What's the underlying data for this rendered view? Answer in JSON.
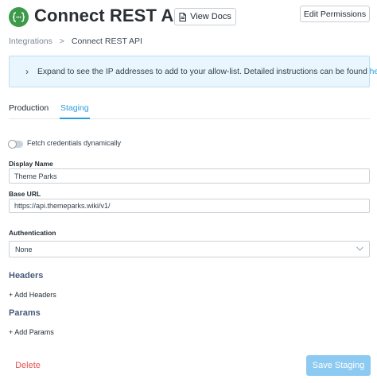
{
  "header": {
    "logo_icon": "rest-api-braces-icon",
    "title": "Connect REST API",
    "view_docs_label": "View Docs",
    "edit_permissions_label": "Edit Permissions",
    "brand_color": "#3c9a4a"
  },
  "breadcrumb": {
    "items": [
      "Integrations",
      "Connect REST API"
    ],
    "separator": ">"
  },
  "banner": {
    "text": "Expand to see the IP addresses to add to your allow-list. Detailed instructions can be found ",
    "link_text": "here",
    "suffix": "."
  },
  "tabs": [
    {
      "label": "Production",
      "active": false
    },
    {
      "label": "Staging",
      "active": true
    }
  ],
  "form": {
    "fetch_dynamic_label": "Fetch credentials dynamically",
    "fetch_dynamic_enabled": false,
    "display_name_label": "Display Name",
    "display_name_value": "Theme Parks",
    "base_url_label": "Base URL",
    "base_url_value": "https://api.themeparks.wiki/v1/",
    "authentication_label": "Authentication",
    "authentication_value": "None"
  },
  "headers_section": {
    "title": "Headers",
    "add_label": "+ Add Headers"
  },
  "params_section": {
    "title": "Params",
    "add_label": "+ Add Params"
  },
  "footer": {
    "delete_label": "Delete",
    "save_label": "Save Staging",
    "accent_color": "#2d9cdb",
    "danger_color": "#e55353"
  }
}
